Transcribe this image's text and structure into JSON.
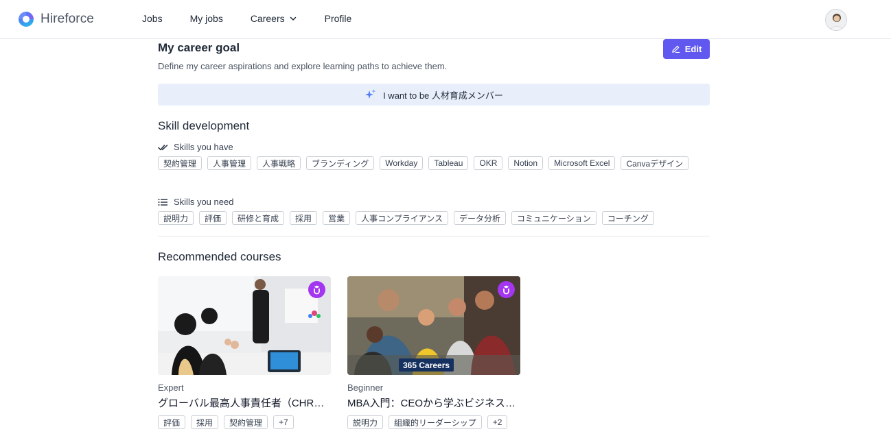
{
  "header": {
    "brand": "Hireforce",
    "nav": [
      {
        "label": "Jobs"
      },
      {
        "label": "My jobs"
      },
      {
        "label": "Careers",
        "has_dropdown": true
      },
      {
        "label": "Profile"
      }
    ],
    "avatar_icon": "user-avatar"
  },
  "career_goal": {
    "title": "My career goal",
    "subtitle": "Define my career aspirations and explore learning paths to achieve them.",
    "edit_label": "Edit",
    "goal_text": "I want to be 人材育成メンバー"
  },
  "skills": {
    "title": "Skill development",
    "have_label": "Skills you have",
    "have": [
      "契約管理",
      "人事管理",
      "人事戦略",
      "ブランディング",
      "Workday",
      "Tableau",
      "OKR",
      "Notion",
      "Microsoft Excel",
      "Canvaデザイン"
    ],
    "need_label": "Skills you need",
    "need": [
      "説明力",
      "評価",
      "研修と育成",
      "採用",
      "営業",
      "人事コンプライアンス",
      "データ分析",
      "コミュニケーション",
      "コーチング"
    ]
  },
  "courses": {
    "title": "Recommended courses",
    "items": [
      {
        "level": "Expert",
        "title": "グローバル最高人事責任者（CHRO）",
        "tags": [
          "評価",
          "採用",
          "契約管理",
          "+7"
        ],
        "provider_icon": "udemy-icon"
      },
      {
        "level": "Beginner",
        "title": "MBA入門：CEOから学ぶビジネスの基礎",
        "tags": [
          "説明力",
          "組織的リーダーシップ",
          "+2"
        ],
        "provider_icon": "udemy-icon",
        "overlay_text": "365 Careers"
      }
    ]
  },
  "colors": {
    "accent": "#6158f0",
    "banner": "#e8effb",
    "udemy": "#a435f0"
  }
}
